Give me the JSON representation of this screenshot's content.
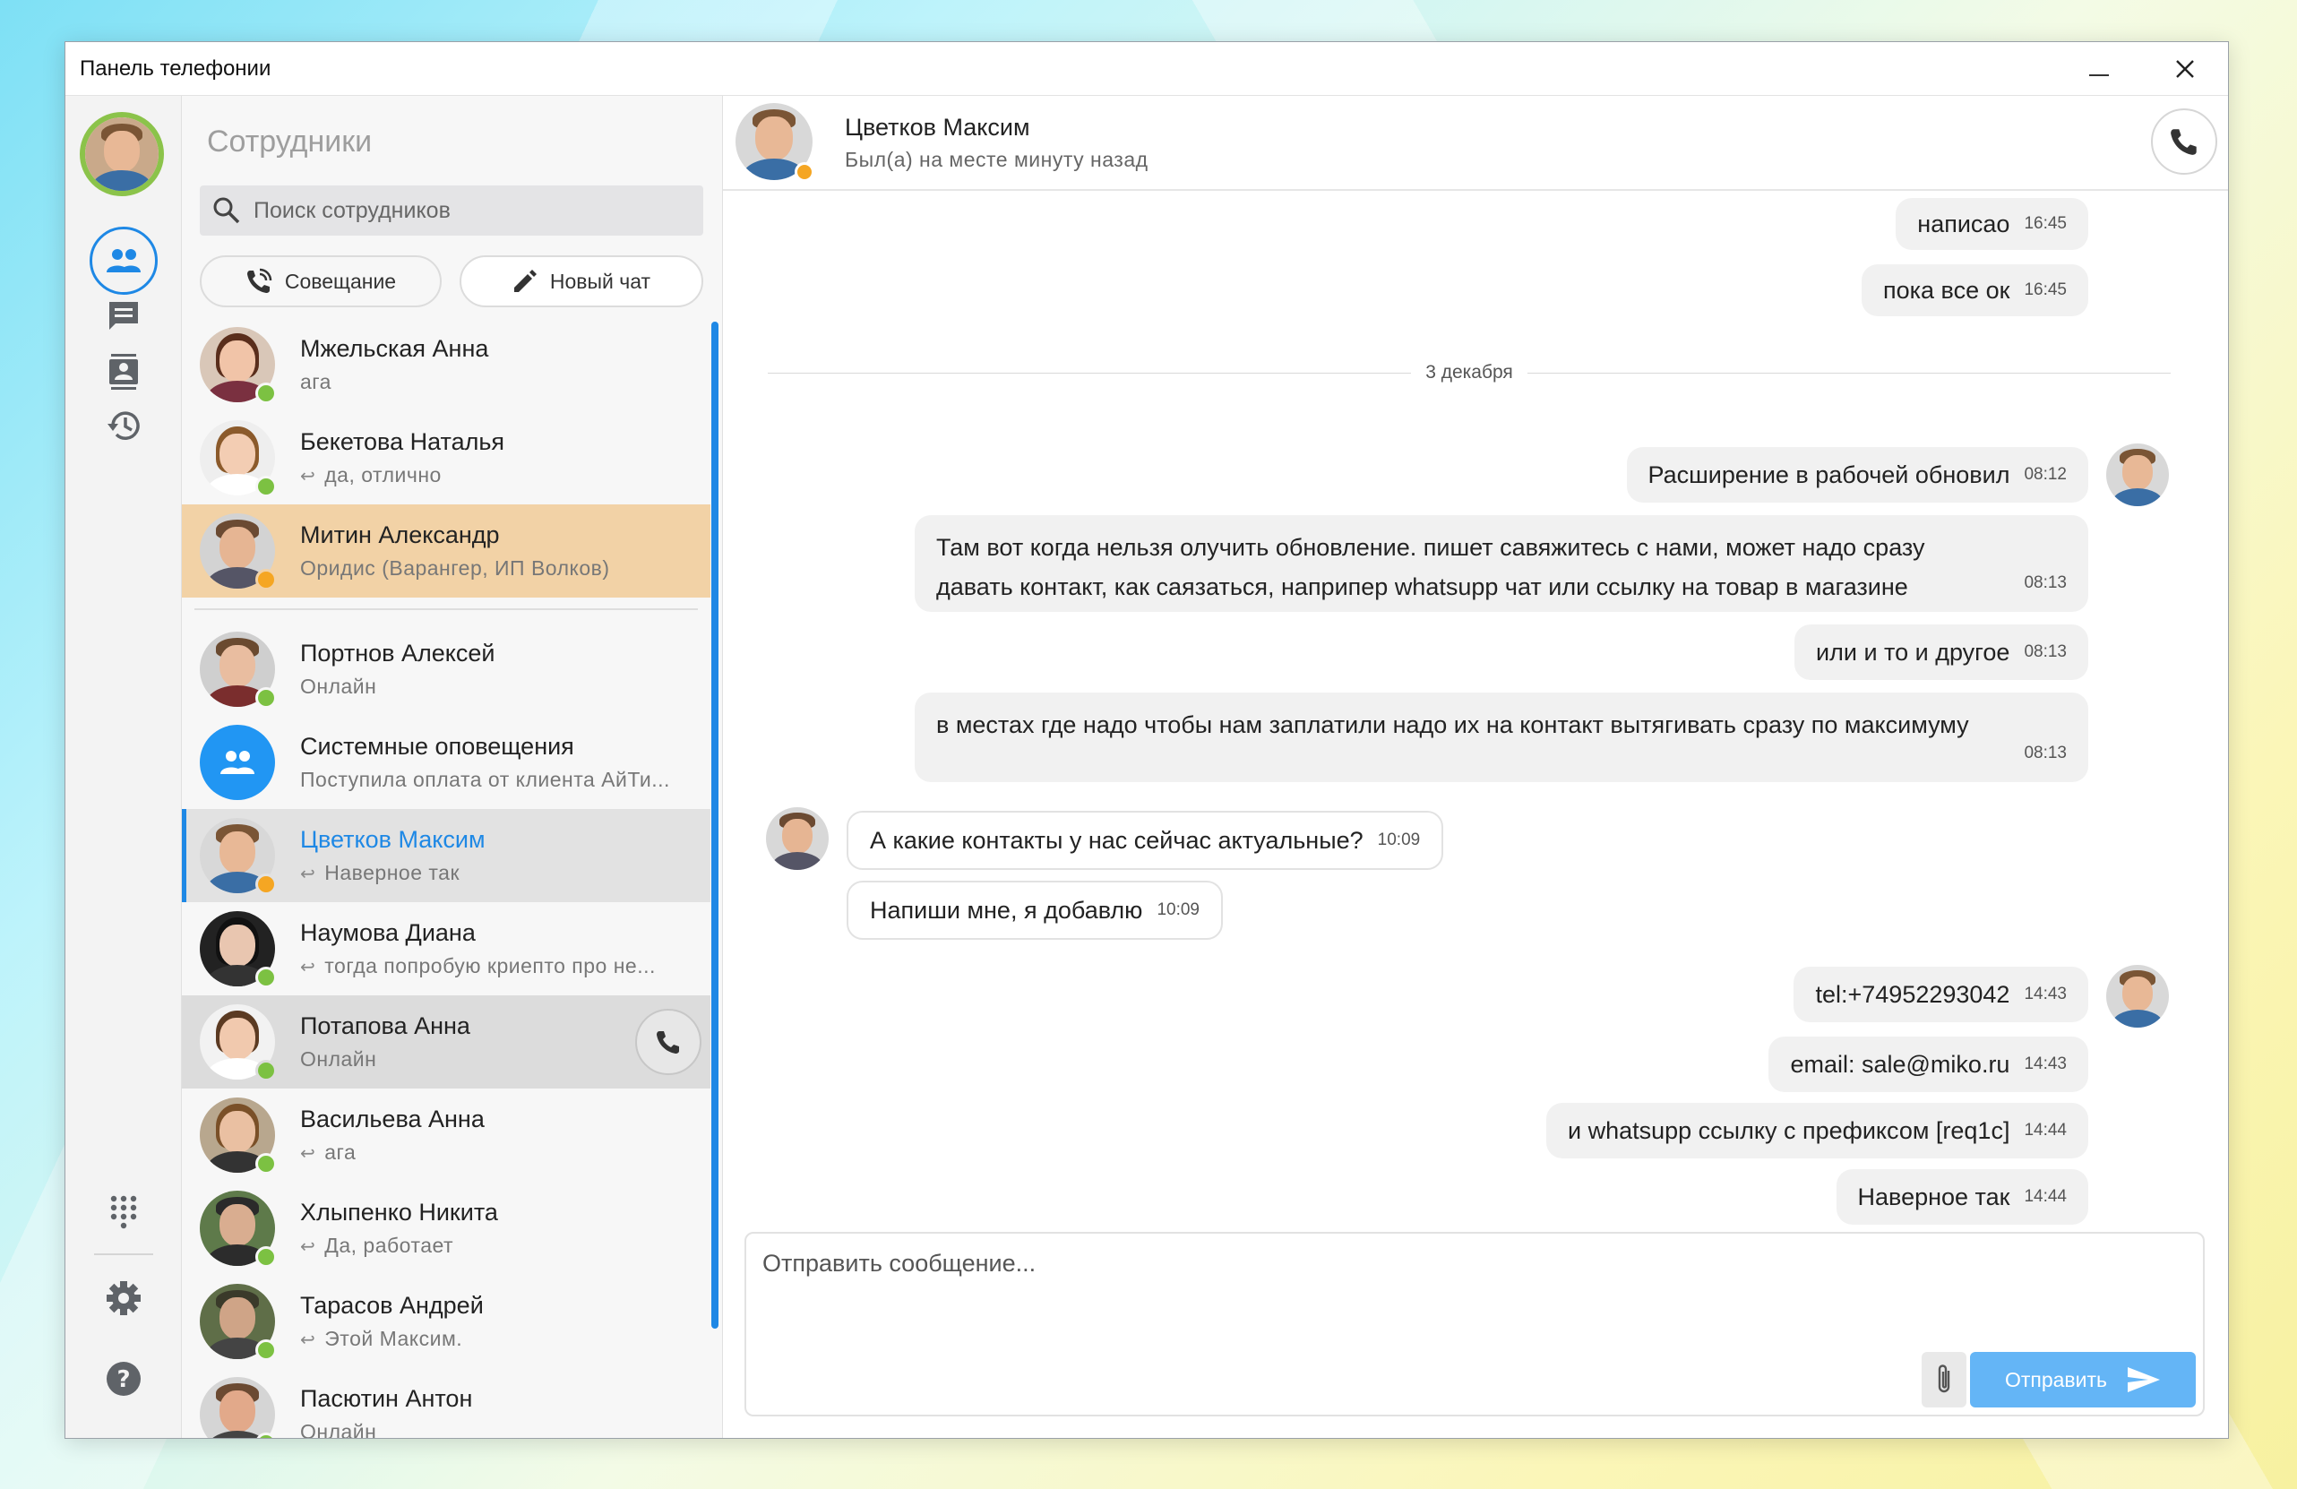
{
  "window": {
    "title": "Панель телефонии"
  },
  "contacts_panel": {
    "heading": "Сотрудники",
    "search_placeholder": "Поиск сотрудников",
    "meeting_label": "Совещание",
    "new_chat_label": "Новый чат",
    "items": [
      {
        "name": "Мжельская Анна",
        "sub": "ага",
        "status": "online",
        "reply": false
      },
      {
        "name": "Бекетова Наталья",
        "sub": "да, отлично",
        "status": "online",
        "reply": true
      },
      {
        "name": "Митин Александр",
        "sub": "Оридис (Варангер, ИП Волков)",
        "status": "away",
        "reply": false
      },
      {
        "name": "Портнов Алексей",
        "sub": "Онлайн",
        "status": "online",
        "reply": false
      },
      {
        "name": "Системные оповещения",
        "sub": "Поступила оплата от клиента АйТи...",
        "status": "none",
        "reply": false
      },
      {
        "name": "Цветков Максим",
        "sub": "Наверное так",
        "status": "away",
        "reply": true
      },
      {
        "name": "Наумова Диана",
        "sub": "тогда попробую криепто про не...",
        "status": "online",
        "reply": true
      },
      {
        "name": "Потапова Анна",
        "sub": "Онлайн",
        "status": "online",
        "reply": false
      },
      {
        "name": "Васильева Анна",
        "sub": "ага",
        "status": "online",
        "reply": true
      },
      {
        "name": "Хлыпенко Никита",
        "sub": "Да, работает",
        "status": "online",
        "reply": true
      },
      {
        "name": "Тарасов Андрей",
        "sub": "Этой Максим.",
        "status": "online",
        "reply": true
      },
      {
        "name": "Пасютин Антон",
        "sub": "Онлайн",
        "status": "online",
        "reply": false
      }
    ]
  },
  "chat": {
    "contact_name": "Цветков Максим",
    "contact_status": "Был(а) на месте минуту назад",
    "date_separator": "3 декабря",
    "messages": [
      {
        "text": "написао",
        "time": "16:45"
      },
      {
        "text": "пока все ок",
        "time": "16:45"
      },
      {
        "text": "Расширение в рабочей обновил",
        "time": "08:12"
      },
      {
        "text": "Там вот когда нельзя олучить обновление. пишет савяжитесь с нами, может надо сразу давать контакт, как саязаться, наприпер whatsupp чат или ссылку на товар в магазине",
        "time": "08:13"
      },
      {
        "text": "или и то и другое",
        "time": "08:13"
      },
      {
        "text": "в местах где надо чтобы нам заплатили надо их на контакт вытягивать сразу по максимуму",
        "time": "08:13"
      },
      {
        "text": "А какие контакты у нас сейчас актуальные?",
        "time": "10:09"
      },
      {
        "text": "Напиши мне, я добавлю",
        "time": "10:09"
      },
      {
        "text": "tel:+74952293042",
        "time": "14:43"
      },
      {
        "text": "email: sale@miko.ru",
        "time": "14:43"
      },
      {
        "text": "и whatsupp ссылку с префиксом [req1c]",
        "time": "14:44"
      },
      {
        "text": "Наверное так",
        "time": "14:44"
      }
    ],
    "composer_placeholder": "Отправить сообщение...",
    "send_label": "Отправить"
  },
  "colors": {
    "accent": "#1e88e5",
    "online": "#7cc142",
    "away": "#f5a623",
    "highlight_row": "#f2d2a6",
    "send_button": "#64b5f6"
  }
}
